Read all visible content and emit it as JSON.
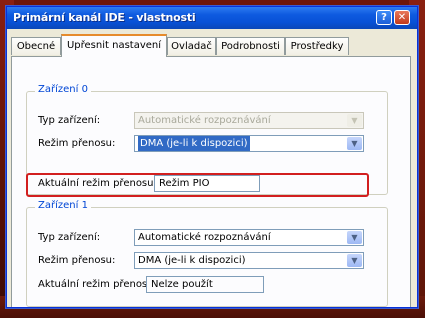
{
  "window": {
    "title": "Primární kanál IDE - vlastnosti"
  },
  "tabs": [
    {
      "label": "Obecné"
    },
    {
      "label": "Upřesnit nastavení"
    },
    {
      "label": "Ovladač"
    },
    {
      "label": "Podrobnosti"
    },
    {
      "label": "Prostředky"
    }
  ],
  "device0": {
    "legend": "Zařízení 0",
    "type_label": "Typ zařízení:",
    "type_value": "Automatické rozpoznávání",
    "mode_label": "Režim přenosu:",
    "mode_value": "DMA (je-li k dispozici)",
    "current_label": "Aktuální režim přenosu:",
    "current_value": "Režim PIO"
  },
  "device1": {
    "legend": "Zařízení 1",
    "type_label": "Typ zařízení:",
    "type_value": "Automatické rozpoznávání",
    "mode_label": "Režim přenosu:",
    "mode_value": "DMA (je-li k dispozici)",
    "current_label": "Aktuální režim přenosu:",
    "current_value": "Nelze použít"
  },
  "colors": {
    "accent": "#0851d6",
    "highlight": "#d21f1f",
    "selection": "#316ac5"
  }
}
